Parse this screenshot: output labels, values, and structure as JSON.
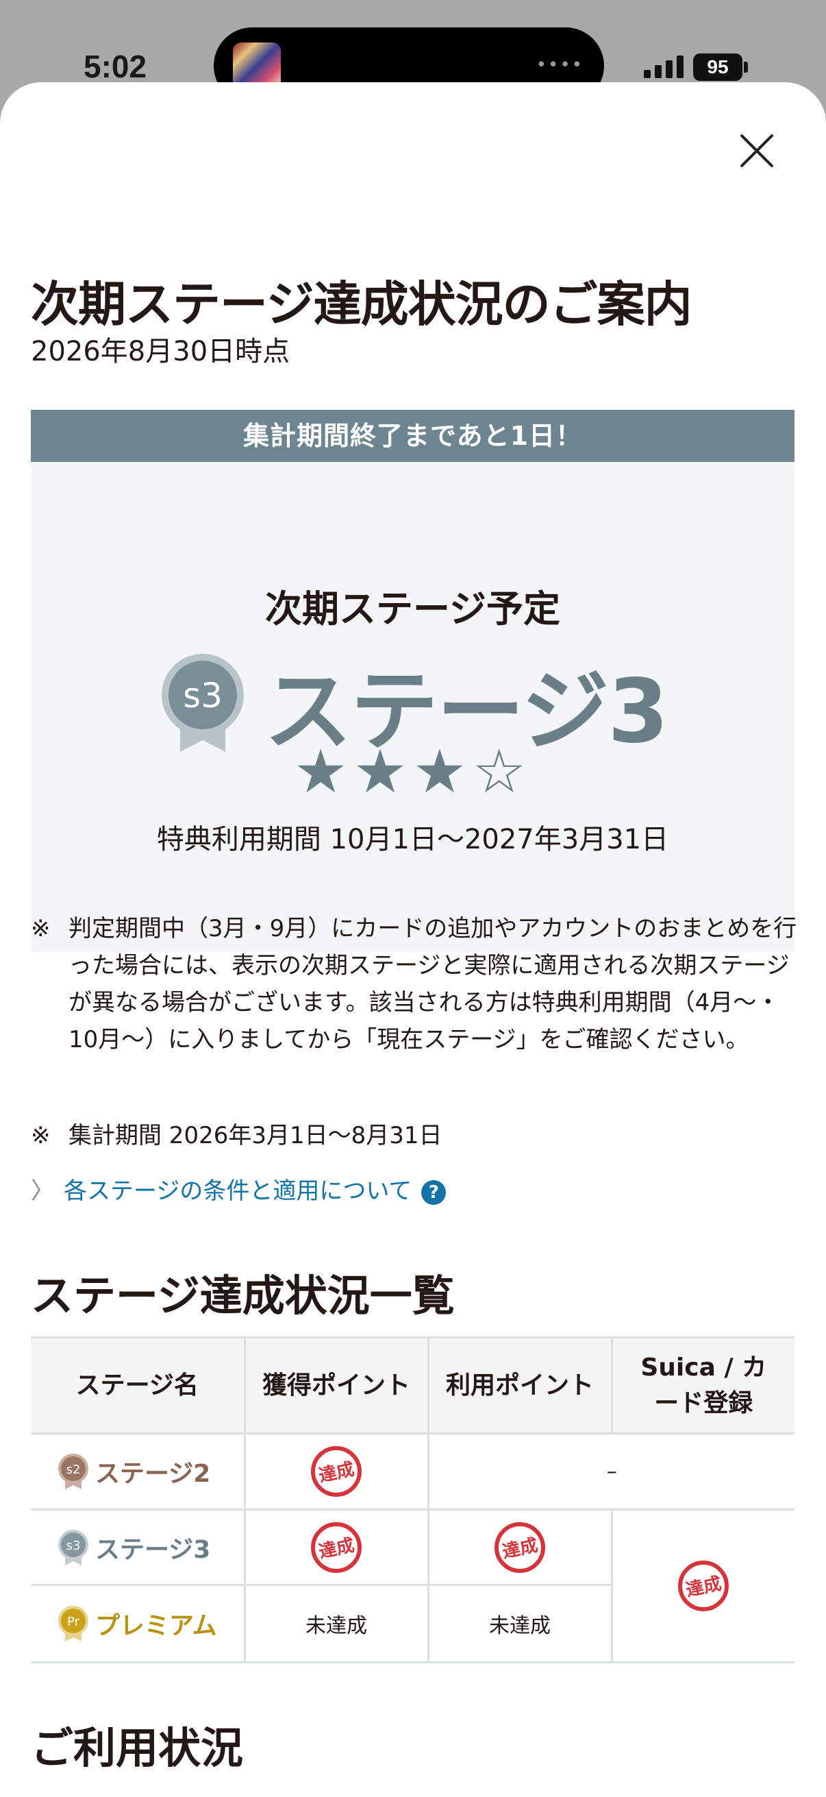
{
  "status_bar": {
    "time": "5:02",
    "battery": "95"
  },
  "sheet": {
    "title": "次期ステージ達成状況のご案内",
    "as_of": "2026年8月30日時点",
    "banner": "集計期間終了まであと1日！",
    "next_stage": {
      "label": "次期ステージ予定",
      "badge": "s3",
      "name": "ステージ3",
      "stars_filled": 3,
      "stars_total": 4,
      "stars_display": "★★★☆",
      "benefit_period": "特典利用期間 10月1日〜2027年3月31日"
    },
    "notes": {
      "mark": "※",
      "judgement": "判定期間中（3月・9月）にカードの追加やアカウントのおまとめを行った場合には、表示の次期ステージと実際に適用される次期ステージが異なる場合がございます。該当される方は特典利用期間（4月〜・10月〜）に入りましてから「現在ステージ」をご確認ください。",
      "period": "集計期間 2026年3月1日〜8月31日"
    },
    "conditions_link": "各ステージの条件と適用について",
    "help_icon": "?",
    "status_section": {
      "title": "ステージ達成状況一覧",
      "headers": [
        "ステージ名",
        "獲得ポイント",
        "利用ポイント",
        "Suica / カード登録"
      ],
      "rows": [
        {
          "badge": "s2",
          "name": "ステージ2",
          "color": "#8b6352",
          "earned": "達成",
          "used": "–",
          "suica": ""
        },
        {
          "badge": "s3",
          "name": "ステージ3",
          "color": "#6a7e88",
          "earned": "達成",
          "used": "達成",
          "suica": "達成"
        },
        {
          "badge": "Pr",
          "name": "プレミアム",
          "color": "#b89111",
          "earned": "未達成",
          "used": "未達成",
          "suica": ""
        }
      ]
    },
    "usage_section": {
      "title": "ご利用状況"
    }
  },
  "colors": {
    "banner": "#6c8591",
    "link": "#1273a8",
    "stamp": "#d7333a"
  }
}
